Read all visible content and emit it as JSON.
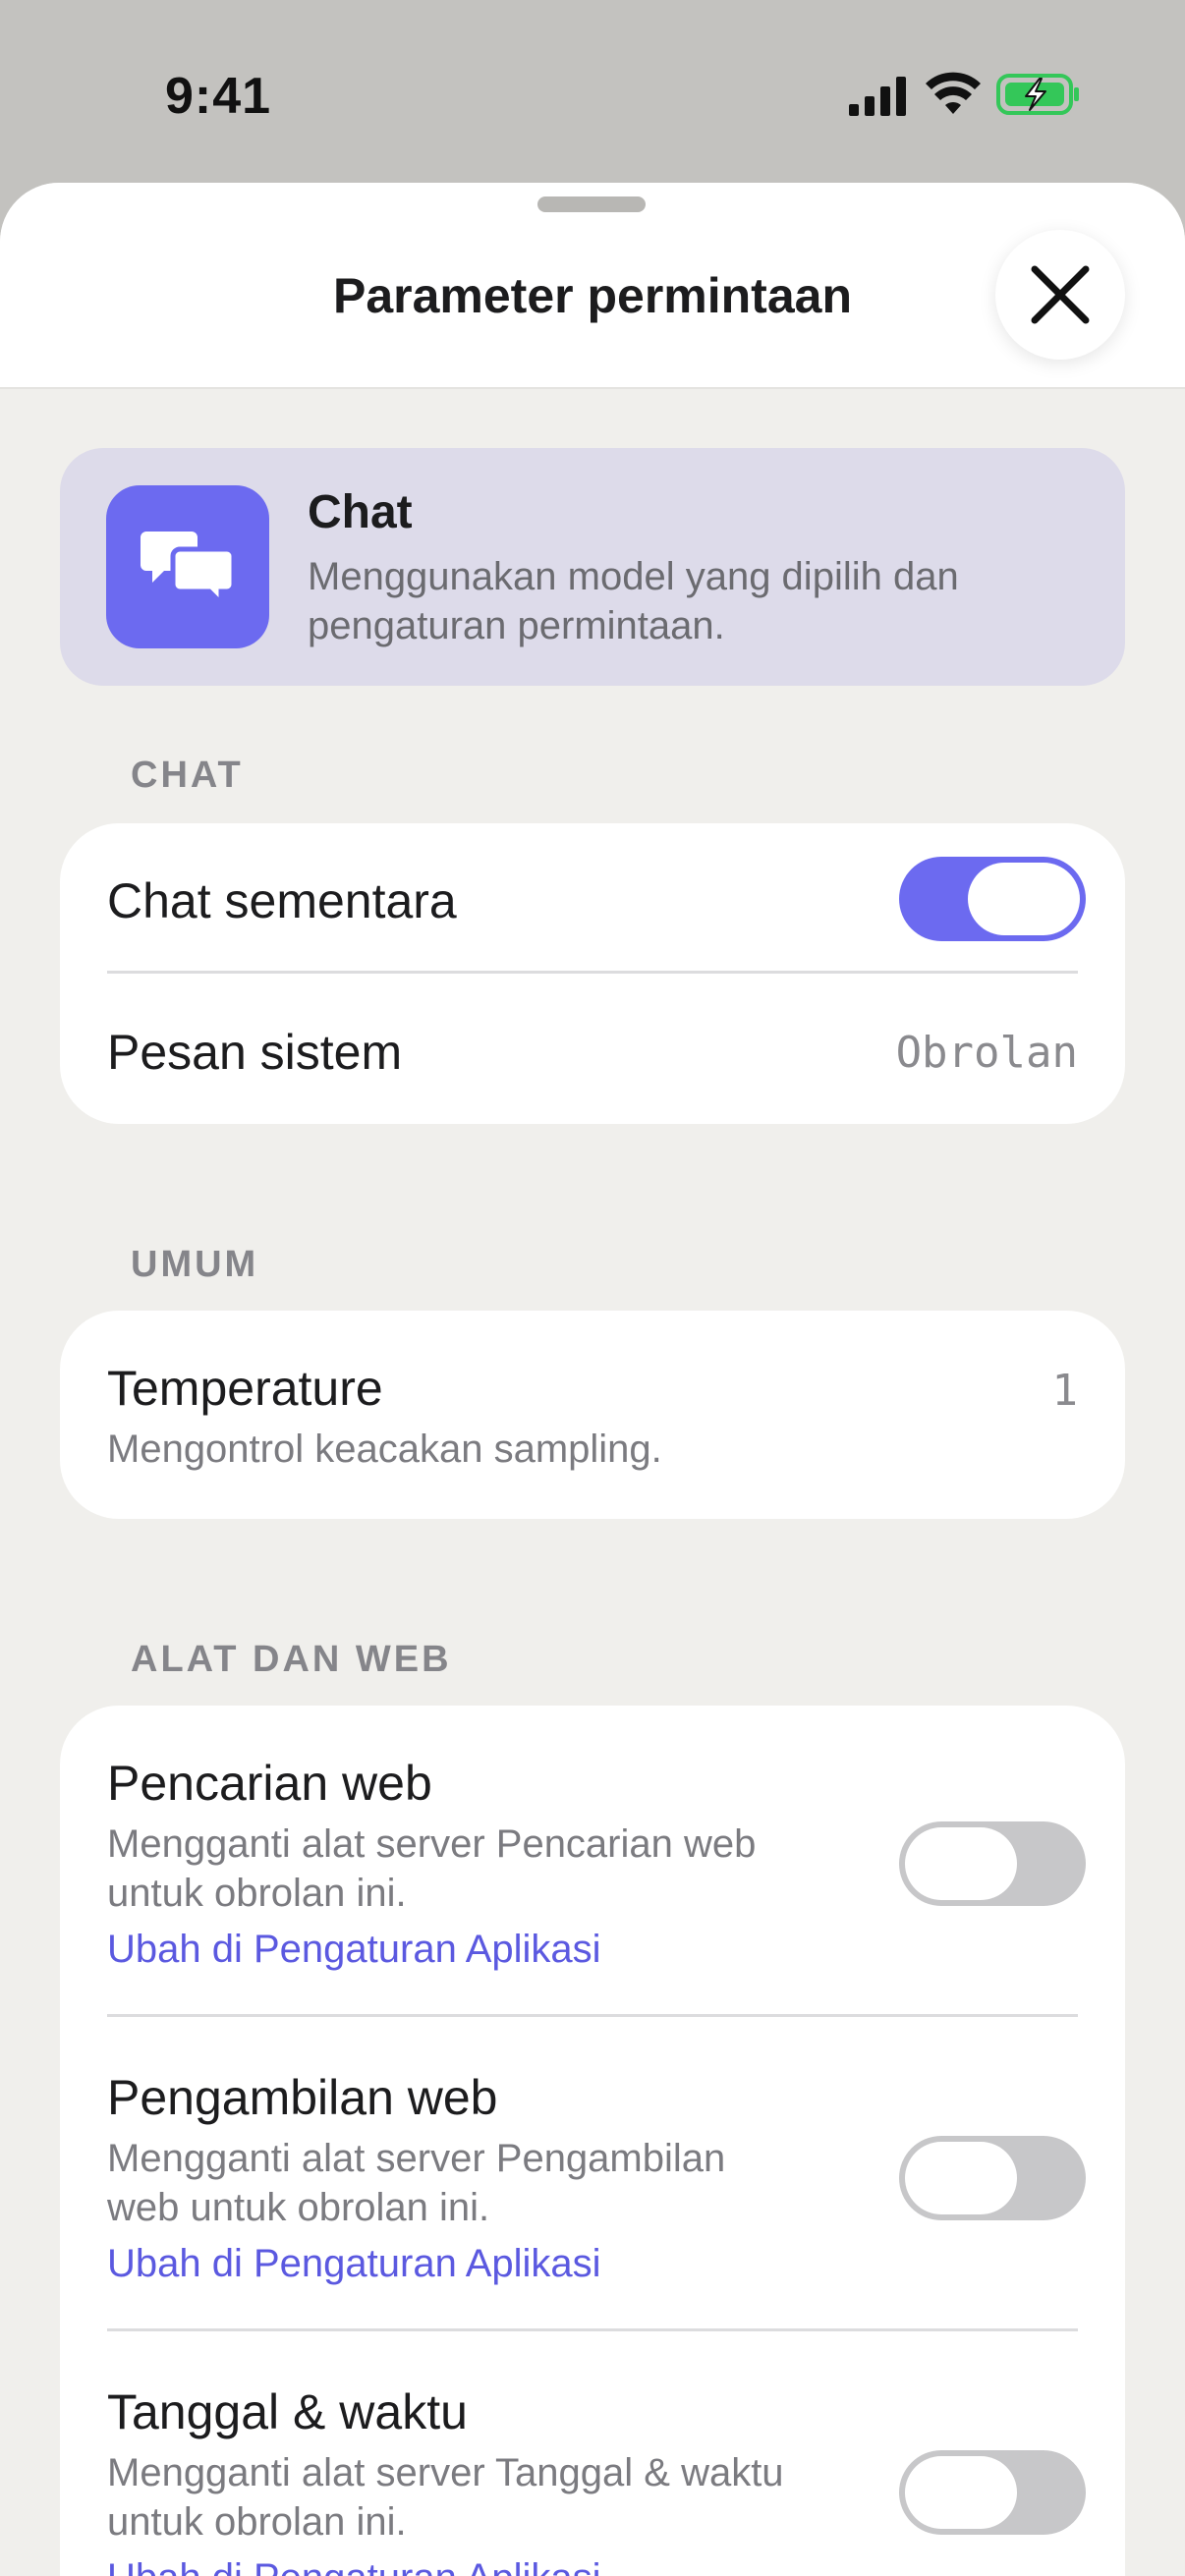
{
  "status_bar": {
    "time": "9:41",
    "signal_icon": "cellular-signal-icon",
    "wifi_icon": "wifi-icon",
    "battery_icon": "battery-charging-icon",
    "battery_color": "#34c759"
  },
  "sheet": {
    "title": "Parameter permintaan",
    "close_icon": "close-icon"
  },
  "mode_card": {
    "icon": "chat-bubbles-icon",
    "title": "Chat",
    "description": "Menggunakan model yang dipilih dan pengaturan permintaan."
  },
  "sections": {
    "chat": {
      "header": "CHAT",
      "temporary_chat": {
        "label": "Chat sementara",
        "enabled": true
      },
      "system_message": {
        "label": "Pesan sistem",
        "value": "Obrolan"
      }
    },
    "general": {
      "header": "UMUM",
      "temperature": {
        "label": "Temperature",
        "description": "Mengontrol keacakan sampling.",
        "value": "1"
      }
    },
    "tools": {
      "header": "ALAT DAN WEB",
      "items": [
        {
          "label": "Pencarian web",
          "description_line1": "Mengganti alat server Pencarian web",
          "description_line2": "untuk obrolan ini.",
          "link": "Ubah di Pengaturan Aplikasi",
          "enabled": false
        },
        {
          "label": "Pengambilan web",
          "description_line1": "Mengganti alat server Pengambilan",
          "description_line2": "web untuk obrolan ini.",
          "link": "Ubah di Pengaturan Aplikasi",
          "enabled": false
        },
        {
          "label": "Tanggal & waktu",
          "description_line1": "Mengganti alat server Tanggal & waktu",
          "description_line2": "untuk obrolan ini.",
          "link": "Ubah di Pengaturan Aplikasi",
          "enabled": false
        }
      ]
    }
  },
  "colors": {
    "accent": "#6c6af0",
    "link": "#5b59e0",
    "toggle_off": "#c7c7c9",
    "sheet_background": "#f0efec",
    "mode_card_background": "#dddbea"
  }
}
